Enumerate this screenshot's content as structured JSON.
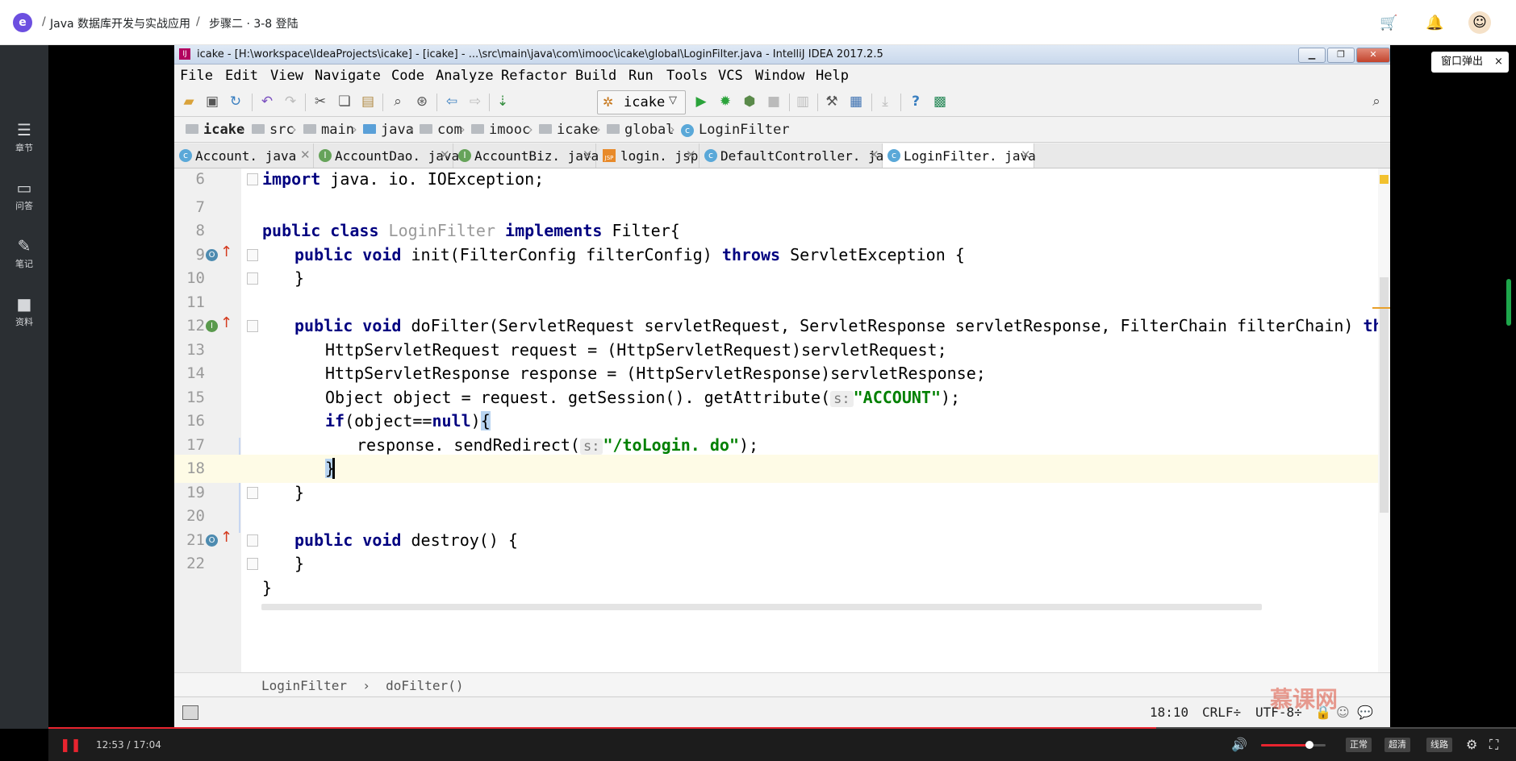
{
  "site": {
    "logo_glyph": "e",
    "breadcrumb": [
      "Java 数据库开发与实战应用",
      "步骤二 · 3-8 登陆"
    ],
    "separator": "/",
    "icons": [
      "cart-icon",
      "bell-icon",
      "avatar"
    ]
  },
  "left_rail": [
    {
      "icon": "chapter-icon",
      "glyph": "☰",
      "label": "章节"
    },
    {
      "icon": "qa-icon",
      "glyph": "▭",
      "label": "问答"
    },
    {
      "icon": "note-icon",
      "glyph": "✎",
      "label": "笔记"
    },
    {
      "icon": "material-icon",
      "glyph": "■",
      "label": "资料"
    }
  ],
  "popout": {
    "label": "窗口弹出",
    "close": "×"
  },
  "ide": {
    "title": "icake - [H:\\workspace\\IdeaProjects\\icake] - [icake] - ...\\src\\main\\java\\com\\imooc\\icake\\global\\LoginFilter.java - IntelliJ IDEA 2017.2.5",
    "menus": [
      "File",
      "Edit",
      "View",
      "Navigate",
      "Code",
      "Analyze",
      "Refactor",
      "Build",
      "Run",
      "Tools",
      "VCS",
      "Window",
      "Help"
    ],
    "run_config": "icake",
    "nav": [
      "icake",
      "src",
      "main",
      "java",
      "com",
      "imooc",
      "icake",
      "global",
      "LoginFilter"
    ],
    "tabs": [
      {
        "label": "Account. java",
        "icon": "C",
        "active": false
      },
      {
        "label": "AccountDao. java",
        "icon": "I",
        "active": false
      },
      {
        "label": "AccountBiz. java",
        "icon": "I",
        "active": false
      },
      {
        "label": "login. jsp",
        "icon": "JSP",
        "active": false
      },
      {
        "label": "DefaultController. java",
        "icon": "C",
        "active": false
      },
      {
        "label": "LoginFilter. java",
        "icon": "C",
        "active": true
      }
    ],
    "line_numbers": [
      "6",
      "7",
      "8",
      "9",
      "10",
      "11",
      "12",
      "13",
      "14",
      "15",
      "16",
      "17",
      "18",
      "19",
      "20",
      "21",
      "22"
    ],
    "code": {
      "l6_kw": "import",
      "l6_rest": " java. io. IOException;",
      "l8_kw1": "public class",
      "l8_cls": "LoginFilter",
      "l8_kw2": "implements",
      "l8_rest": " Filter{",
      "l9_kw": "public void",
      "l9_rest": " init(FilterConfig filterConfig) ",
      "l9_kw2": "throws",
      "l9_rest2": " ServletException {",
      "l10": "}",
      "l12_kw": "public void",
      "l12_rest": " doFilter(ServletRequest servletRequest, ServletResponse servletResponse, FilterChain filterChain) ",
      "l12_kw2": "thro",
      "l13": "HttpServletRequest request = (HttpServletRequest)servletRequest;",
      "l14": "HttpServletResponse response = (HttpServletResponse)servletResponse;",
      "l15_a": "Object object = request. getSession(). getAttribute(",
      "l15_hint": "s:",
      "l15_str": "\"ACCOUNT\"",
      "l15_b": ");",
      "l16_kw": "if",
      "l16_a": "(object==",
      "l16_kw2": "null",
      "l16_b": ")",
      "l16_brace": "{",
      "l17_a": "response. sendRedirect(",
      "l17_hint": "s:",
      "l17_str": "\"/toLogin. do\"",
      "l17_b": ");",
      "l18": "}",
      "l19": "}",
      "l21_kw": "public void",
      "l21_rest": " destroy() {",
      "l22": "}",
      "l23": "}"
    },
    "breadcrumb_bar": "LoginFilter  ›  doFilter()",
    "status": {
      "position": "18:10",
      "line_sep": "CRLF÷",
      "encoding": "UTF-8÷"
    }
  },
  "watermark": "慕课网",
  "player": {
    "time": "12:53 / 17:04",
    "progress": 0.755,
    "volume": 0.75,
    "quality_buttons": [
      "正常",
      "超清",
      "线路"
    ]
  }
}
